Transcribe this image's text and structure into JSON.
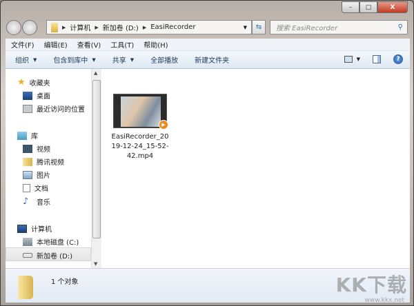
{
  "window": {
    "minimize": "–",
    "maximize": "□",
    "close": "X"
  },
  "address": {
    "crumbs": [
      "计算机",
      "新加卷 (D:)",
      "EasiRecorder"
    ]
  },
  "search": {
    "placeholder": "搜索 EasiRecorder"
  },
  "menu": [
    "文件(F)",
    "编辑(E)",
    "查看(V)",
    "工具(T)",
    "帮助(H)"
  ],
  "toolbar": {
    "organize": "组织",
    "include": "包含到库中",
    "share": "共享",
    "play_all": "全部播放",
    "new_folder": "新建文件夹",
    "help": "?"
  },
  "sidebar": {
    "favorites": "收藏夹",
    "desktop": "桌面",
    "recent": "最近访问的位置",
    "libraries": "库",
    "videos": "视频",
    "tencent_video": "腾讯视频",
    "pictures": "图片",
    "documents": "文档",
    "music": "音乐",
    "computer": "计算机",
    "drive_c": "本地磁盘 (C:)",
    "drive_d": "新加卷 (D:)"
  },
  "files": [
    {
      "name": "EasiRecorder_2019-12-24_15-52-42.mp4"
    }
  ],
  "status": {
    "count": "1 个对象"
  },
  "watermark": {
    "logo": "KK下载",
    "url": "www.kkx.net"
  }
}
